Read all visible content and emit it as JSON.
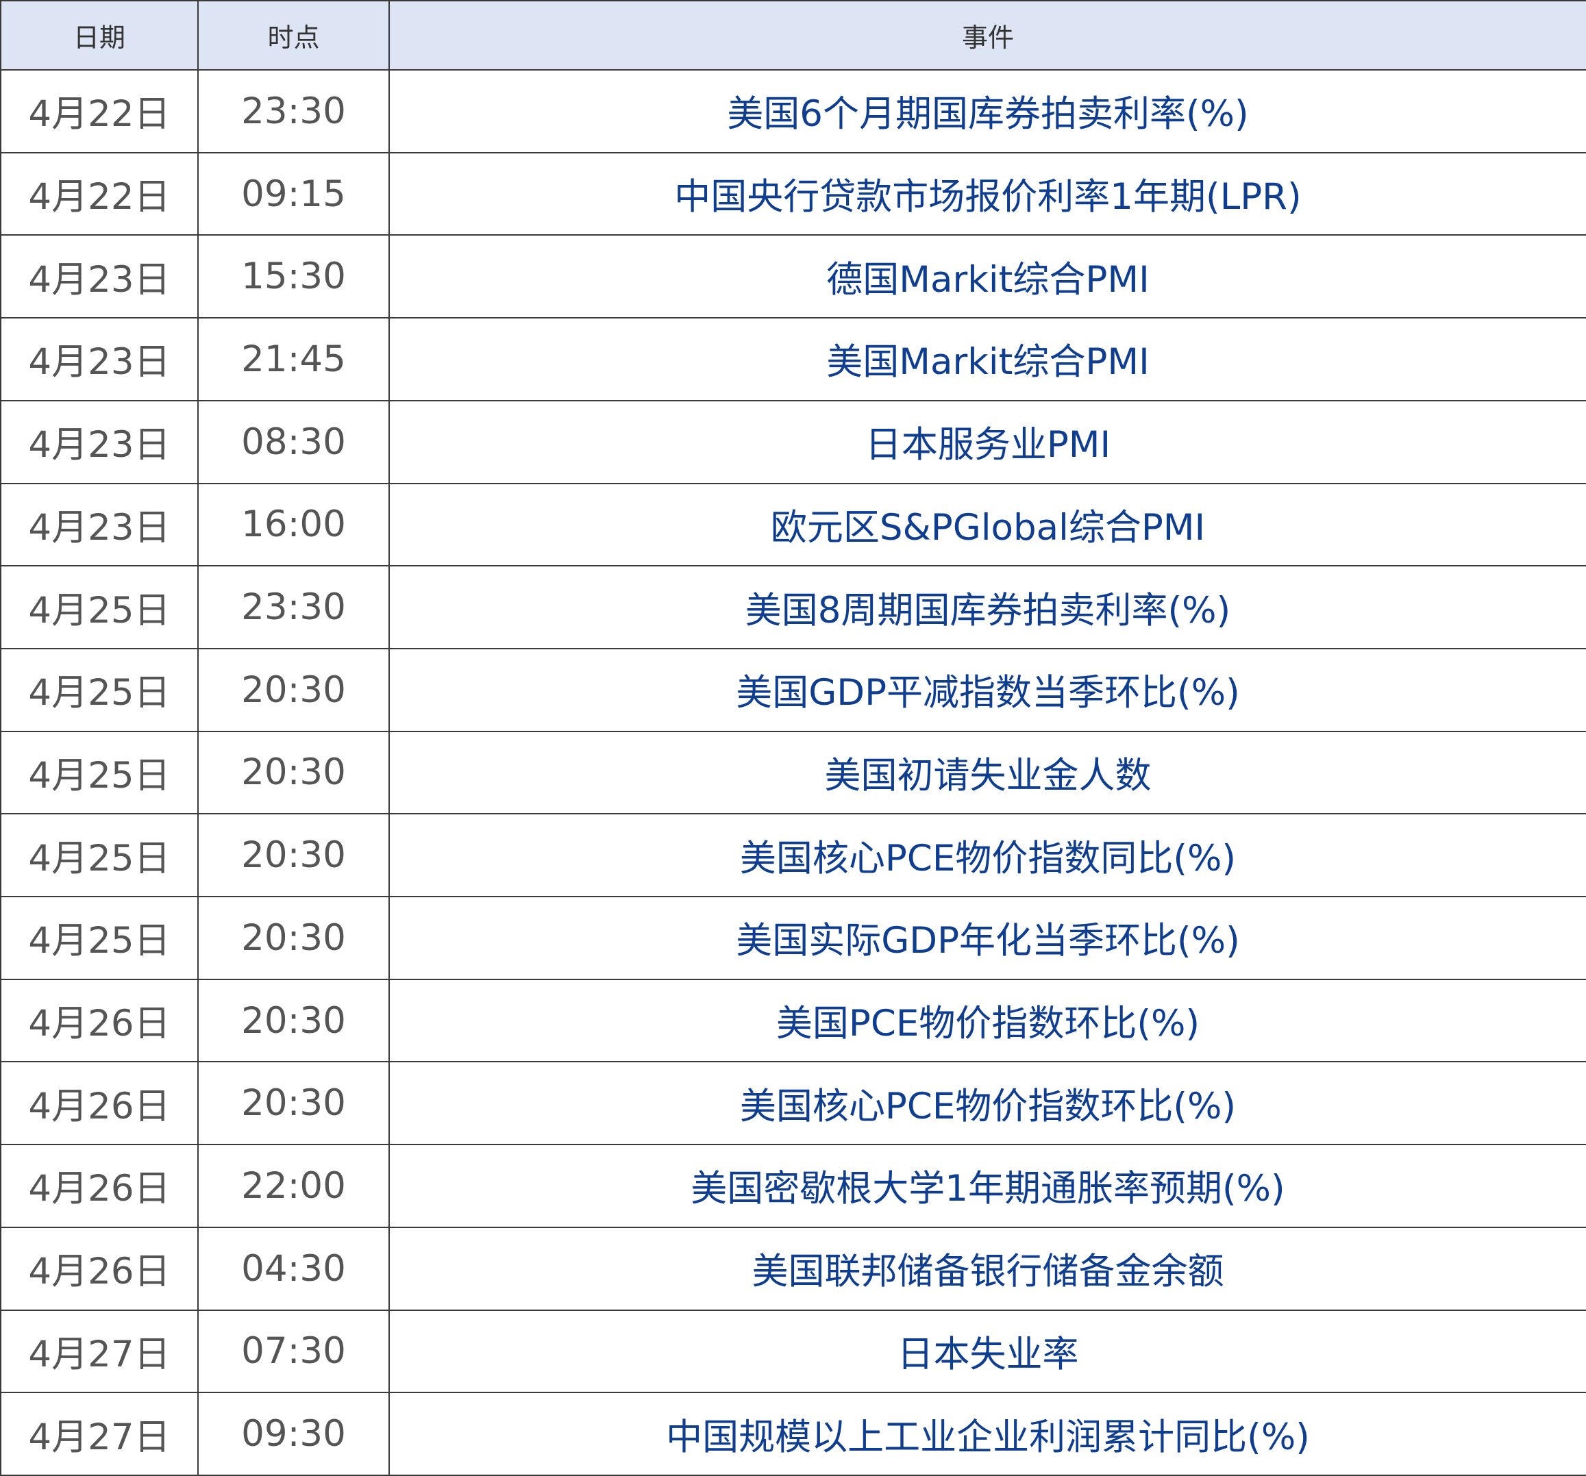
{
  "header": {
    "date": "日期",
    "time": "时点",
    "event": "事件"
  },
  "rows": [
    {
      "date": "4月22日",
      "time": "23:30",
      "event": "美国6个月期国库券拍卖利率(%)"
    },
    {
      "date": "4月22日",
      "time": "09:15",
      "event": "中国央行贷款市场报价利率1年期(LPR)"
    },
    {
      "date": "4月23日",
      "time": "15:30",
      "event": "德国Markit综合PMI"
    },
    {
      "date": "4月23日",
      "time": "21:45",
      "event": "美国Markit综合PMI"
    },
    {
      "date": "4月23日",
      "time": "08:30",
      "event": "日本服务业PMI"
    },
    {
      "date": "4月23日",
      "time": "16:00",
      "event": "欧元区S&PGlobal综合PMI"
    },
    {
      "date": "4月25日",
      "time": "23:30",
      "event": "美国8周期国库券拍卖利率(%)"
    },
    {
      "date": "4月25日",
      "time": "20:30",
      "event": "美国GDP平减指数当季环比(%)"
    },
    {
      "date": "4月25日",
      "time": "20:30",
      "event": "美国初请失业金人数"
    },
    {
      "date": "4月25日",
      "time": "20:30",
      "event": "美国核心PCE物价指数同比(%)"
    },
    {
      "date": "4月25日",
      "time": "20:30",
      "event": "美国实际GDP年化当季环比(%)"
    },
    {
      "date": "4月26日",
      "time": "20:30",
      "event": "美国PCE物价指数环比(%)"
    },
    {
      "date": "4月26日",
      "time": "20:30",
      "event": "美国核心PCE物价指数环比(%)"
    },
    {
      "date": "4月26日",
      "time": "22:00",
      "event": "美国密歇根大学1年期通胀率预期(%)"
    },
    {
      "date": "4月26日",
      "time": "04:30",
      "event": "美国联邦储备银行储备金余额"
    },
    {
      "date": "4月27日",
      "time": "07:30",
      "event": "日本失业率"
    },
    {
      "date": "4月27日",
      "time": "09:30",
      "event": "中国规模以上工业企业利润累计同比(%)"
    }
  ],
  "colors": {
    "header_background": "#dde4f3",
    "event_text": "#0f3d8f",
    "date_time_text": "#555555",
    "grid_line": "#3a3a3a"
  }
}
